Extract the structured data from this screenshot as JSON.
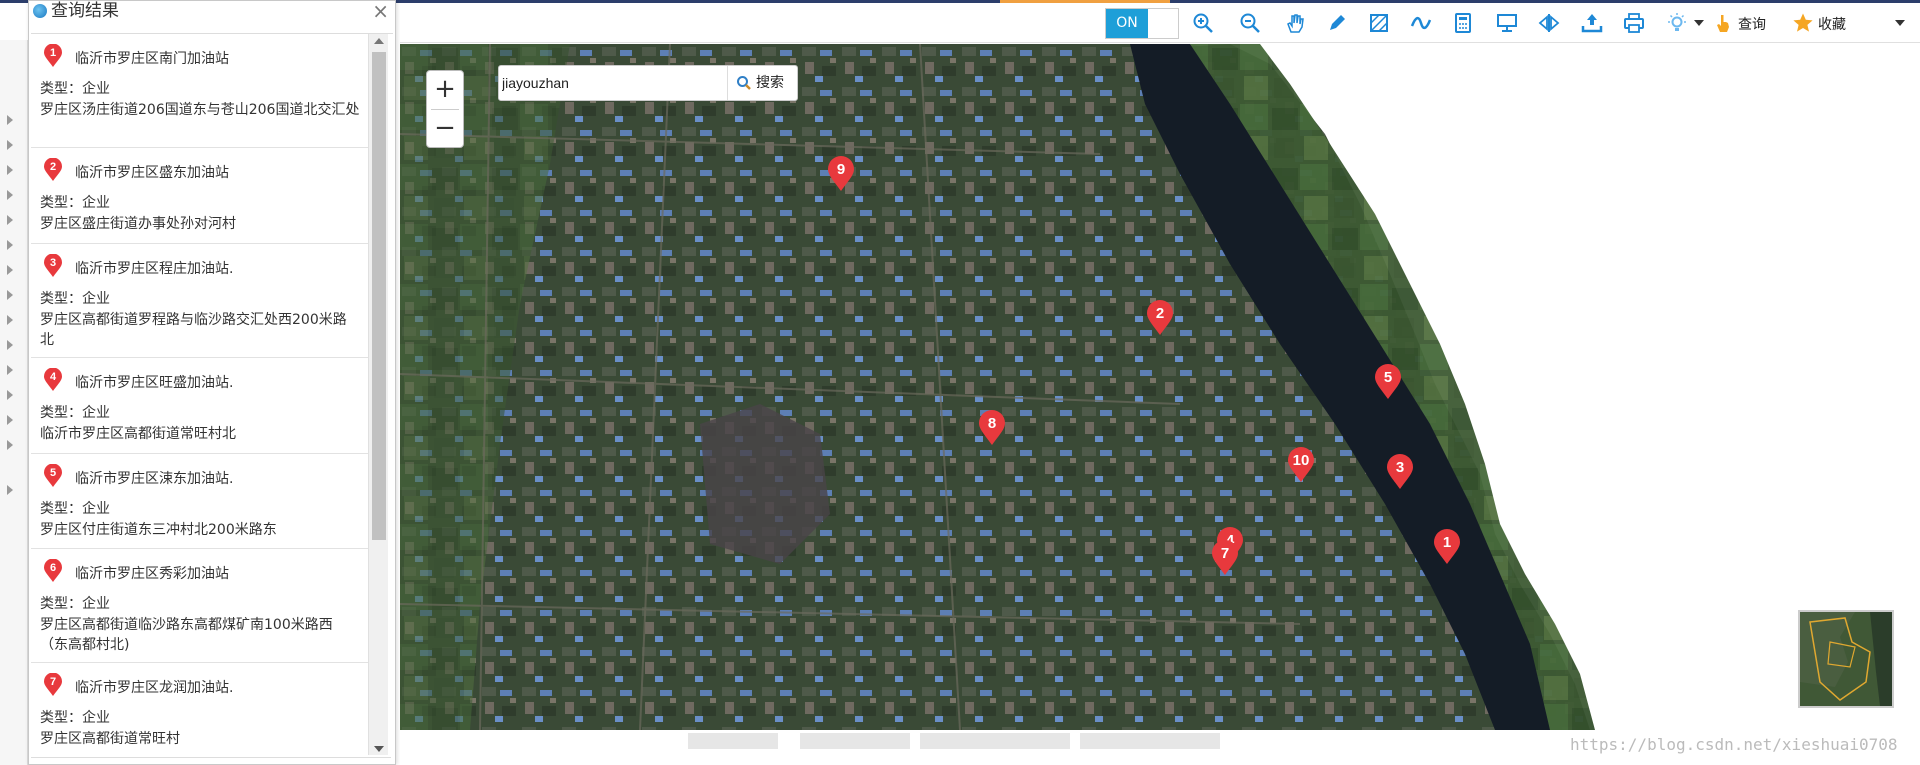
{
  "panel": {
    "title": "查询结果",
    "close_label": "×",
    "results": [
      {
        "num": "1",
        "name": "临沂市罗庄区南门加油站",
        "type": "类型：企业",
        "address": "罗庄区汤庄街道206国道东与苍山206国道北交汇处"
      },
      {
        "num": "2",
        "name": "临沂市罗庄区盛东加油站",
        "type": "类型：企业",
        "address": "罗庄区盛庄街道办事处孙对河村"
      },
      {
        "num": "3",
        "name": "临沂市罗庄区程庄加油站.",
        "type": "类型：企业",
        "address": "罗庄区高都街道罗程路与临沙路交汇处西200米路北"
      },
      {
        "num": "4",
        "name": "临沂市罗庄区旺盛加油站.",
        "type": "类型：企业",
        "address": "临沂市罗庄区高都街道常旺村北"
      },
      {
        "num": "5",
        "name": "临沂市罗庄区涑东加油站.",
        "type": "类型：企业",
        "address": "罗庄区付庄街道东三冲村北200米路东"
      },
      {
        "num": "6",
        "name": "临沂市罗庄区秀彩加油站",
        "type": "类型：企业",
        "address": "罗庄区高都街道临沙路东高都煤矿南100米路西（东高都村北)"
      },
      {
        "num": "7",
        "name": "临沂市罗庄区龙润加油站.",
        "type": "类型：企业",
        "address": "罗庄区高都街道常旺村"
      }
    ]
  },
  "toolbar": {
    "toggle_label": "ON",
    "query_label": "查询",
    "favorites_label": "收藏"
  },
  "map": {
    "search_value": "jiayouzhan",
    "search_button": "搜索",
    "zoom_in": "+",
    "zoom_out": "−",
    "markers": [
      "9",
      "2",
      "5",
      "8",
      "10",
      "3",
      "1",
      "4",
      "7"
    ]
  },
  "footer": {
    "watermark": "https://blog.csdn.net/xieshuai0708"
  },
  "colors": {
    "marker": "#e8393d",
    "toggle_on": "#1e9fd8",
    "toolbar_icon": "#1e88d6",
    "favorite_star": "#f5a623"
  }
}
